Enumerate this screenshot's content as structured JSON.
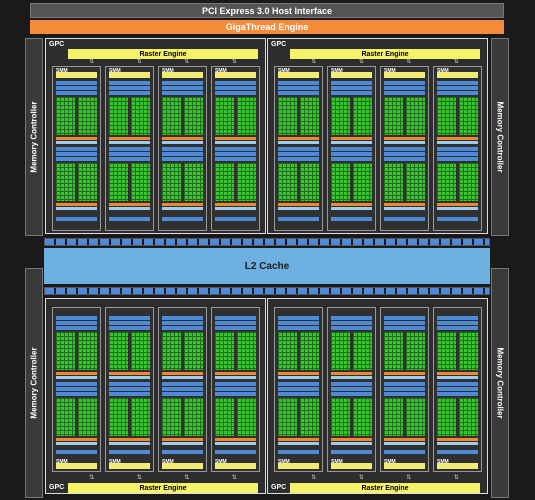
{
  "header": {
    "host_interface": "PCI Express 3.0 Host Interface",
    "giga_thread": "GigaThread Engine"
  },
  "memory_controller_label": "Memory Controller",
  "gpc_label": "GPC",
  "raster_engine_label": "Raster Engine",
  "smm_label": "SMM",
  "l2_cache_label": "L2 Cache",
  "colors": {
    "giga_thread": "#f58a38",
    "raster_engine": "#f4f36a",
    "cuda_cores": "#39c430",
    "l2_cache": "#6fb0e2",
    "memory_bus": "#4f8ad6"
  },
  "counts": {
    "gpcs": 4,
    "smms_per_gpc": 4,
    "memory_controllers": 4
  }
}
